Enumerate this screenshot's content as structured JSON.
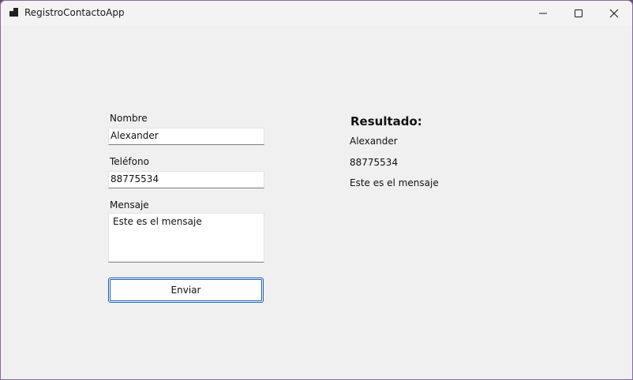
{
  "window": {
    "title": "RegistroContactoApp",
    "icon": "app-window-icon",
    "controls": {
      "minimize_icon": "minimize-icon",
      "maximize_icon": "maximize-icon",
      "close_icon": "close-icon"
    }
  },
  "form": {
    "name_label": "Nombre",
    "name_value": "Alexander",
    "phone_label": "Teléfono",
    "phone_value": "88775534",
    "message_label": "Mensaje",
    "message_value": "Este es el mensaje",
    "submit_label": "Enviar"
  },
  "result": {
    "heading": "Resultado:",
    "name": "Alexander",
    "phone": "88775534",
    "message": "Este es el mensaje"
  },
  "colors": {
    "window_background": "#f0f0f0",
    "button_focus_border": "#1a5fb4",
    "desktop_edge": "#6b4a7a"
  }
}
